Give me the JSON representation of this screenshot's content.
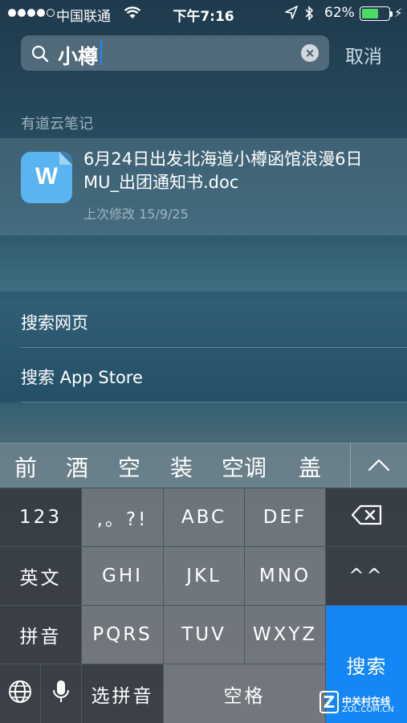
{
  "status_bar": {
    "carrier": "中国联通",
    "time": "下午7:16",
    "battery_percent": "62%",
    "battery_level": 0.62,
    "signal_bars": 4,
    "icons": [
      "signal-dots-icon",
      "wifi-icon",
      "location-arrow-icon",
      "bluetooth-icon",
      "battery-icon",
      "charging-bolt-icon"
    ]
  },
  "search": {
    "query": "小樽",
    "cancel_label": "取消"
  },
  "results": {
    "section_title": "有道云笔记",
    "items": [
      {
        "title": "6月24日出发北海道小樽函馆浪漫6日MU_出团通知书.doc",
        "meta": "上次修改 15/9/25",
        "icon_letter": "W",
        "icon": "word-document-icon"
      }
    ]
  },
  "web_actions": [
    "搜索网页",
    "搜索 App Store"
  ],
  "candidates": [
    "前",
    "酒",
    "空",
    "装",
    "空调",
    "盖"
  ],
  "keyboard": {
    "rows": [
      [
        "123",
        ",。?!",
        "ABC",
        "DEF",
        "delete"
      ],
      [
        "英文",
        "GHI",
        "JKL",
        "MNO",
        "^^"
      ],
      [
        "拼音",
        "PQRS",
        "TUV",
        "WXYZ"
      ],
      [
        "globe",
        "mic",
        "选拼音",
        "空格"
      ]
    ],
    "return_label": "搜索"
  },
  "watermark": {
    "brand_cn": "中关村在线",
    "brand_en": "ZOL.COM.CN",
    "logo_letter": "Z"
  },
  "colors": {
    "accent_blue": "#1586f5",
    "caret": "#1a8cff",
    "battery_green": "#4cd964",
    "doc_icon_blue": "#5ab4ef"
  }
}
